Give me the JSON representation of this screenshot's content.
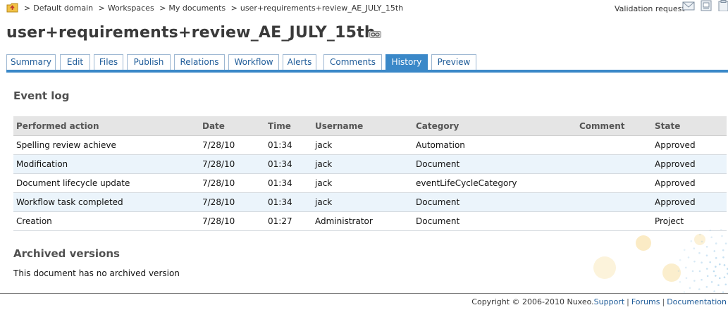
{
  "breadcrumb": {
    "items": [
      "Default domain",
      "Workspaces",
      "My documents",
      "user+requirements+review_AE_JULY_15th"
    ],
    "separator": ">"
  },
  "header": {
    "validation_label": "Validation request",
    "icons": [
      "mail-icon",
      "print-icon",
      "clipboard-icon"
    ]
  },
  "document": {
    "title": "user+requirements+review_AE_JULY_15th"
  },
  "tabs": [
    {
      "label": "Summary",
      "active": false
    },
    {
      "label": "Edit",
      "active": false
    },
    {
      "label": "Files",
      "active": false
    },
    {
      "label": "Publish",
      "active": false
    },
    {
      "label": "Relations",
      "active": false
    },
    {
      "label": "Workflow",
      "active": false
    },
    {
      "label": "Alerts",
      "active": false
    },
    {
      "label": "Comments",
      "active": false
    },
    {
      "label": "History",
      "active": true
    },
    {
      "label": "Preview",
      "active": false
    }
  ],
  "event_log": {
    "heading": "Event log",
    "columns": [
      "Performed action",
      "Date",
      "Time",
      "Username",
      "Category",
      "Comment",
      "State"
    ],
    "rows": [
      [
        "Spelling review achieve",
        "7/28/10",
        "01:34",
        "jack",
        "Automation",
        "",
        "Approved"
      ],
      [
        "Modification",
        "7/28/10",
        "01:34",
        "jack",
        "Document",
        "",
        "Approved"
      ],
      [
        "Document lifecycle update",
        "7/28/10",
        "01:34",
        "jack",
        "eventLifeCycleCategory",
        "",
        "Approved"
      ],
      [
        "Workflow task completed",
        "7/28/10",
        "01:34",
        "jack",
        "Document",
        "",
        "Approved"
      ],
      [
        "Creation",
        "7/28/10",
        "01:27",
        "Administrator",
        "Document",
        "",
        "Project"
      ]
    ]
  },
  "archived": {
    "heading": "Archived versions",
    "empty_text": "This document has no archived version"
  },
  "footer": {
    "copyright": "Copyright © 2006-2010 Nuxeo.",
    "links": [
      "Support",
      "Forums",
      "Documentation"
    ]
  },
  "colors": {
    "accent": "#3a88c8",
    "link": "#1f5c99",
    "row_alt": "#ebf4fb",
    "decor": "#f3c75a"
  }
}
